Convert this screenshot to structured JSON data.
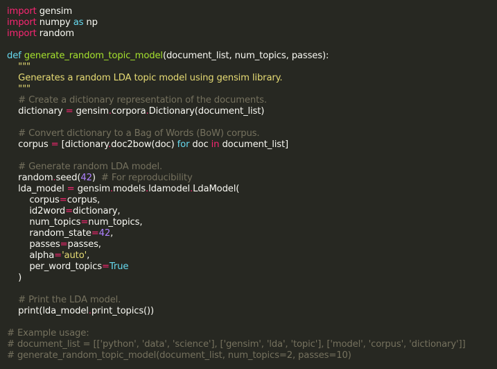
{
  "editor": {
    "colors": {
      "background": "#272822",
      "keyword": "#f92672",
      "def": "#66d9ef",
      "func": "#a6e22e",
      "op": "#f92672",
      "string": "#e6db74",
      "comment": "#75715e",
      "number": "#ae81ff",
      "const": "#66d9ef",
      "plain": "#f8f8f2"
    },
    "lines": [
      [
        [
          "keyword",
          "import"
        ],
        [
          "plain",
          " gensim"
        ]
      ],
      [
        [
          "keyword",
          "import"
        ],
        [
          "plain",
          " numpy "
        ],
        [
          "def",
          "as"
        ],
        [
          "plain",
          " np"
        ]
      ],
      [
        [
          "keyword",
          "import"
        ],
        [
          "plain",
          " random"
        ]
      ],
      [],
      [
        [
          "def",
          "def"
        ],
        [
          "plain",
          " "
        ],
        [
          "func",
          "generate_random_topic_model"
        ],
        [
          "plain",
          "(document_list, num_topics, passes):"
        ]
      ],
      [
        [
          "plain",
          "    "
        ],
        [
          "string",
          "\"\"\""
        ]
      ],
      [
        [
          "plain",
          "    "
        ],
        [
          "string",
          "Generates a random LDA topic model using gensim library."
        ]
      ],
      [
        [
          "plain",
          "    "
        ],
        [
          "string",
          "\"\"\""
        ]
      ],
      [
        [
          "plain",
          "    "
        ],
        [
          "comment",
          "# Create a dictionary representation of the documents."
        ]
      ],
      [
        [
          "plain",
          "    dictionary "
        ],
        [
          "op",
          "="
        ],
        [
          "plain",
          " gensim"
        ],
        [
          "op",
          "."
        ],
        [
          "plain",
          "corpora"
        ],
        [
          "op",
          "."
        ],
        [
          "plain",
          "Dictionary(document_list)"
        ]
      ],
      [],
      [
        [
          "plain",
          "    "
        ],
        [
          "comment",
          "# Convert dictionary to a Bag of Words (BoW) corpus."
        ]
      ],
      [
        [
          "plain",
          "    corpus "
        ],
        [
          "op",
          "="
        ],
        [
          "plain",
          " [dictionary"
        ],
        [
          "op",
          "."
        ],
        [
          "plain",
          "doc2bow(doc) "
        ],
        [
          "def",
          "for"
        ],
        [
          "plain",
          " doc "
        ],
        [
          "keyword",
          "in"
        ],
        [
          "plain",
          " document_list]"
        ]
      ],
      [],
      [
        [
          "plain",
          "    "
        ],
        [
          "comment",
          "# Generate random LDA model."
        ]
      ],
      [
        [
          "plain",
          "    random"
        ],
        [
          "op",
          "."
        ],
        [
          "plain",
          "seed("
        ],
        [
          "number",
          "42"
        ],
        [
          "plain",
          ")  "
        ],
        [
          "comment",
          "# For reproducibility"
        ]
      ],
      [
        [
          "plain",
          "    lda_model "
        ],
        [
          "op",
          "="
        ],
        [
          "plain",
          " gensim"
        ],
        [
          "op",
          "."
        ],
        [
          "plain",
          "models"
        ],
        [
          "op",
          "."
        ],
        [
          "plain",
          "ldamodel"
        ],
        [
          "op",
          "."
        ],
        [
          "plain",
          "LdaModel("
        ]
      ],
      [
        [
          "plain",
          "        corpus"
        ],
        [
          "op",
          "="
        ],
        [
          "plain",
          "corpus,"
        ]
      ],
      [
        [
          "plain",
          "        id2word"
        ],
        [
          "op",
          "="
        ],
        [
          "plain",
          "dictionary,"
        ]
      ],
      [
        [
          "plain",
          "        num_topics"
        ],
        [
          "op",
          "="
        ],
        [
          "plain",
          "num_topics,"
        ]
      ],
      [
        [
          "plain",
          "        random_state"
        ],
        [
          "op",
          "="
        ],
        [
          "number",
          "42"
        ],
        [
          "plain",
          ","
        ]
      ],
      [
        [
          "plain",
          "        passes"
        ],
        [
          "op",
          "="
        ],
        [
          "plain",
          "passes,"
        ]
      ],
      [
        [
          "plain",
          "        alpha"
        ],
        [
          "op",
          "="
        ],
        [
          "string",
          "'auto'"
        ],
        [
          "plain",
          ","
        ]
      ],
      [
        [
          "plain",
          "        per_word_topics"
        ],
        [
          "op",
          "="
        ],
        [
          "const",
          "True"
        ]
      ],
      [
        [
          "plain",
          "    )"
        ]
      ],
      [],
      [
        [
          "plain",
          "    "
        ],
        [
          "comment",
          "# Print the LDA model."
        ]
      ],
      [
        [
          "plain",
          "    print(lda_model"
        ],
        [
          "op",
          "."
        ],
        [
          "plain",
          "print_topics())"
        ]
      ],
      [],
      [
        [
          "comment",
          "# Example usage:"
        ]
      ],
      [
        [
          "comment",
          "# document_list = [['python', 'data', 'science'], ['gensim', 'lda', 'topic'], ['model', 'corpus', 'dictionary']]"
        ]
      ],
      [
        [
          "comment",
          "# generate_random_topic_model(document_list, num_topics=2, passes=10)"
        ]
      ]
    ]
  }
}
